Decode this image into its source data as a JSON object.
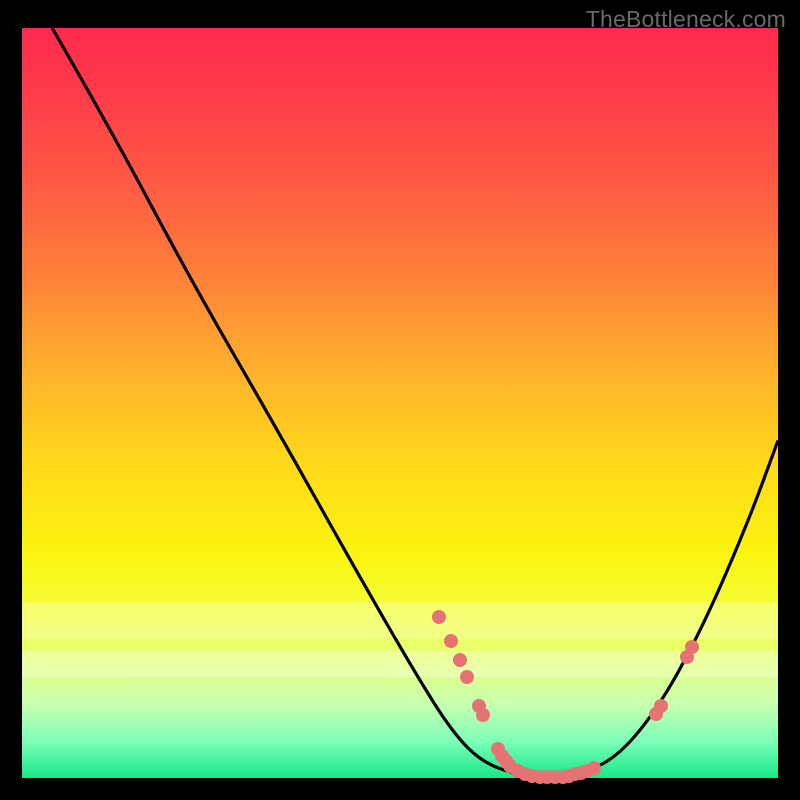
{
  "attribution": "TheBottleneck.com",
  "chart_data": {
    "type": "line",
    "title": "",
    "xlabel": "",
    "ylabel": "",
    "xlim": [
      0,
      100
    ],
    "ylim": [
      0,
      100
    ],
    "curve": [
      {
        "x": 4.0,
        "y": 100.0
      },
      {
        "x": 12.0,
        "y": 86.0
      },
      {
        "x": 22.0,
        "y": 67.0
      },
      {
        "x": 34.0,
        "y": 46.0
      },
      {
        "x": 44.0,
        "y": 28.0
      },
      {
        "x": 52.0,
        "y": 14.0
      },
      {
        "x": 57.0,
        "y": 6.0
      },
      {
        "x": 61.0,
        "y": 2.0
      },
      {
        "x": 66.0,
        "y": 0.3
      },
      {
        "x": 72.0,
        "y": 0.3
      },
      {
        "x": 78.0,
        "y": 2.0
      },
      {
        "x": 84.0,
        "y": 9.0
      },
      {
        "x": 90.0,
        "y": 20.0
      },
      {
        "x": 96.0,
        "y": 34.0
      },
      {
        "x": 100.0,
        "y": 45.0
      }
    ],
    "points": [
      {
        "x": 55.2,
        "y": 21.5
      },
      {
        "x": 56.8,
        "y": 18.3
      },
      {
        "x": 58.0,
        "y": 15.7
      },
      {
        "x": 58.9,
        "y": 13.5
      },
      {
        "x": 60.5,
        "y": 9.6
      },
      {
        "x": 61.0,
        "y": 8.4
      },
      {
        "x": 63.0,
        "y": 3.9
      },
      {
        "x": 63.5,
        "y": 3.0
      },
      {
        "x": 64.0,
        "y": 2.3
      },
      {
        "x": 64.6,
        "y": 1.6
      },
      {
        "x": 65.6,
        "y": 0.9
      },
      {
        "x": 66.5,
        "y": 0.5
      },
      {
        "x": 67.5,
        "y": 0.3
      },
      {
        "x": 68.5,
        "y": 0.2
      },
      {
        "x": 69.5,
        "y": 0.2
      },
      {
        "x": 70.5,
        "y": 0.2
      },
      {
        "x": 71.5,
        "y": 0.2
      },
      {
        "x": 72.3,
        "y": 0.3
      },
      {
        "x": 73.2,
        "y": 0.5
      },
      {
        "x": 74.0,
        "y": 0.7
      },
      {
        "x": 74.8,
        "y": 1.0
      },
      {
        "x": 75.6,
        "y": 1.4
      },
      {
        "x": 83.8,
        "y": 8.5
      },
      {
        "x": 84.5,
        "y": 9.6
      },
      {
        "x": 88.0,
        "y": 16.2
      },
      {
        "x": 88.6,
        "y": 17.5
      }
    ],
    "pale_bands_y": [
      {
        "from": 18.5,
        "to": 23.5
      },
      {
        "from": 13.5,
        "to": 17.0
      }
    ],
    "colors": {
      "curve": "#000000",
      "points": "#e57373",
      "gradient_top": "#ff2a4e",
      "gradient_mid": "#ffd91a",
      "gradient_bottom": "#16e887",
      "attribution": "#6a6a6a",
      "frame": "#000000"
    }
  }
}
